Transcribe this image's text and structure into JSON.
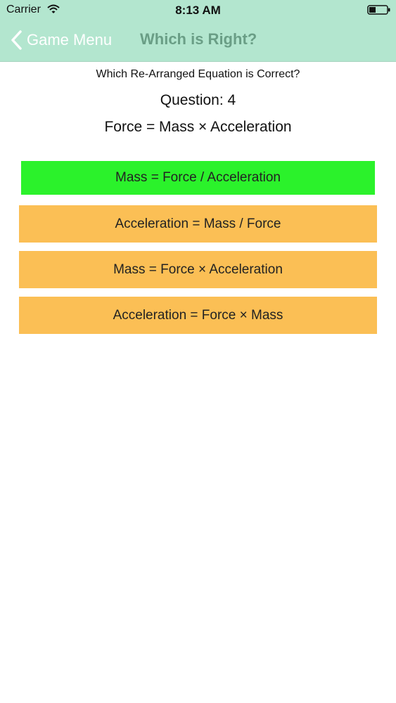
{
  "status_bar": {
    "carrier": "Carrier",
    "time": "8:13 AM",
    "wifi_icon": "wifi-icon",
    "battery_icon": "battery-icon"
  },
  "nav": {
    "back_label": "Game Menu",
    "back_icon": "chevron-left-icon",
    "title": "Which is Right?"
  },
  "quiz": {
    "prompt": "Which Re-Arranged Equation is Correct?",
    "question_label": "Question: 4",
    "equation": "Force = Mass × Acceleration",
    "answers": [
      {
        "label": "Mass = Force / Acceleration",
        "state": "correct"
      },
      {
        "label": "Acceleration = Mass / Force",
        "state": "unselected"
      },
      {
        "label": "Mass = Force × Acceleration",
        "state": "unselected"
      },
      {
        "label": "Acceleration = Force × Mass",
        "state": "unselected"
      }
    ]
  },
  "colors": {
    "nav_background": "#b3e6cf",
    "nav_title": "#6a9e86",
    "correct_answer": "#2bf22b",
    "answer_option": "#fbbf55"
  }
}
